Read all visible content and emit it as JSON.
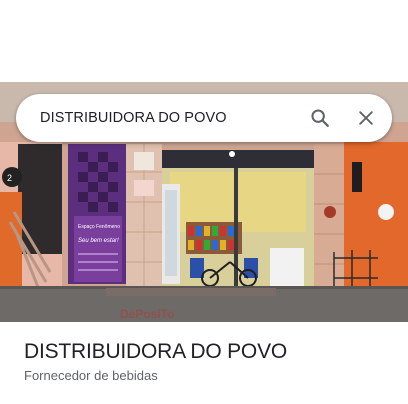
{
  "search": {
    "value": "DISTRIBUIDORA DO POVO",
    "search_icon": "search-icon",
    "close_icon": "close-icon"
  },
  "place": {
    "name": "DISTRIBUIDORA DO POVO",
    "category": "Fornecedor de bebidas",
    "photo": {
      "sign_text": "Espaço Fenômeno",
      "banner_line": "Seu bem estar!",
      "left_sign_number": "2",
      "ground_text": "DePosiTo"
    }
  },
  "colors": {
    "text_primary": "#202124",
    "text_secondary": "#5f6368",
    "icon": "#5f6368",
    "wall_orange": "#e2682c",
    "wall_purple": "#5b2f7e",
    "floor": "#6e6a68"
  }
}
